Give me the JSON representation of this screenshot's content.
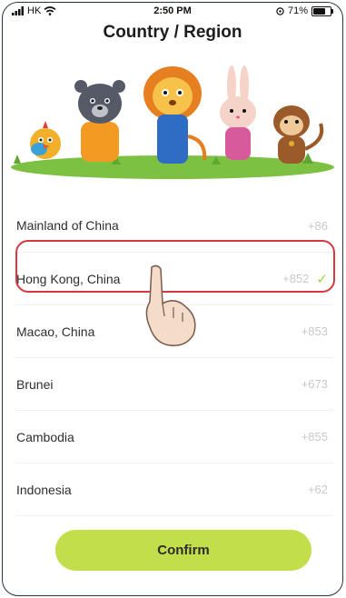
{
  "status_bar": {
    "carrier": "HK",
    "time": "2:50 PM",
    "battery": "71%"
  },
  "header": {
    "title": "Country / Region"
  },
  "countries": [
    {
      "name": "Mainland of China",
      "code": "+86",
      "selected": false
    },
    {
      "name": "Hong Kong, China",
      "code": "+852",
      "selected": true
    },
    {
      "name": "Macao, China",
      "code": "+853",
      "selected": false
    },
    {
      "name": "Brunei",
      "code": "+673",
      "selected": false
    },
    {
      "name": "Cambodia",
      "code": "+855",
      "selected": false
    },
    {
      "name": "Indonesia",
      "code": "+62",
      "selected": false
    }
  ],
  "confirm_label": "Confirm",
  "colors": {
    "accent": "#c2de4b",
    "check": "#9fd13a",
    "highlight": "#d93640"
  },
  "icons": [
    "signal-icon",
    "wifi-icon",
    "location-icon",
    "battery-icon",
    "checkmark-icon",
    "tap-hand-icon"
  ]
}
